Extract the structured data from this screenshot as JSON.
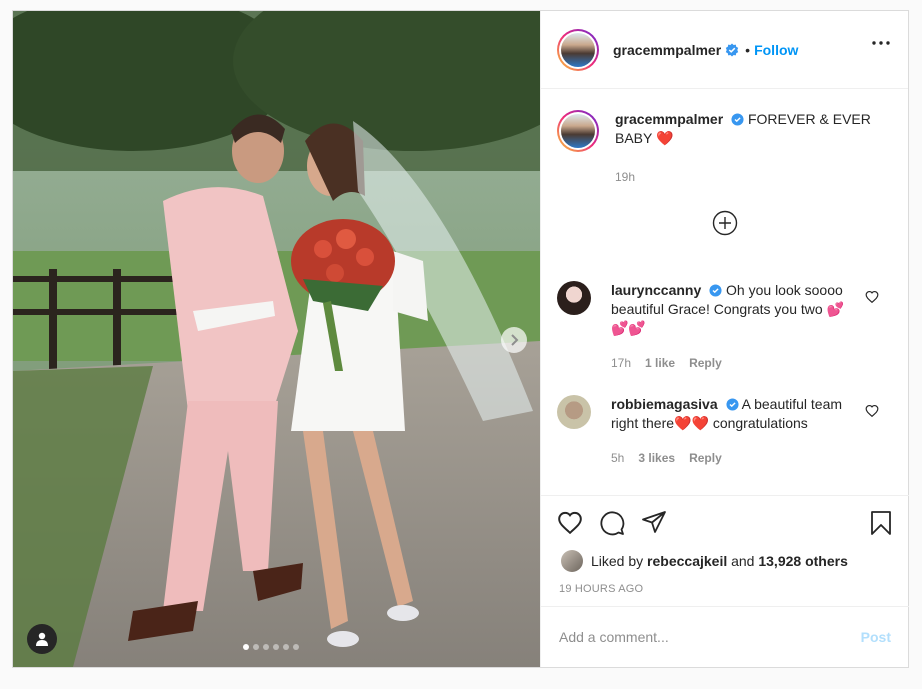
{
  "post": {
    "author": "gracemmpalmer",
    "follow_label": "Follow",
    "separator": "•",
    "caption_text": "FOREVER & EVER BABY",
    "caption_time": "19h",
    "carousel": {
      "slide_count": 6,
      "active_index": 0
    }
  },
  "comments": [
    {
      "username": "laurynccanny",
      "text": "Oh you look soooo beautiful Grace! Congrats you two",
      "hearts": 3,
      "time": "17h",
      "likes": "1 like",
      "reply": "Reply"
    },
    {
      "username": "robbiemagasiva",
      "text": "A beautiful team right there",
      "text_after": "congratulations",
      "hearts": 2,
      "time": "5h",
      "likes": "3 likes",
      "reply": "Reply"
    }
  ],
  "likes": {
    "prefix": "Liked by",
    "first_liker": "rebeccajkeil",
    "conjunction": "and",
    "others": "13,928 others"
  },
  "timestamp": "19 HOURS AGO",
  "add_comment": {
    "placeholder": "Add a comment...",
    "post_label": "Post"
  },
  "colors": {
    "accent": "#0095f6",
    "verified": "#3897f0",
    "heart": "#ed4956",
    "post_disabled": "#b2dffc"
  },
  "icons": [
    "user-tag-icon",
    "chevron-right-icon",
    "more-icon",
    "verified-icon",
    "add-circle-icon",
    "heart-icon",
    "comment-icon",
    "share-icon",
    "save-icon"
  ]
}
